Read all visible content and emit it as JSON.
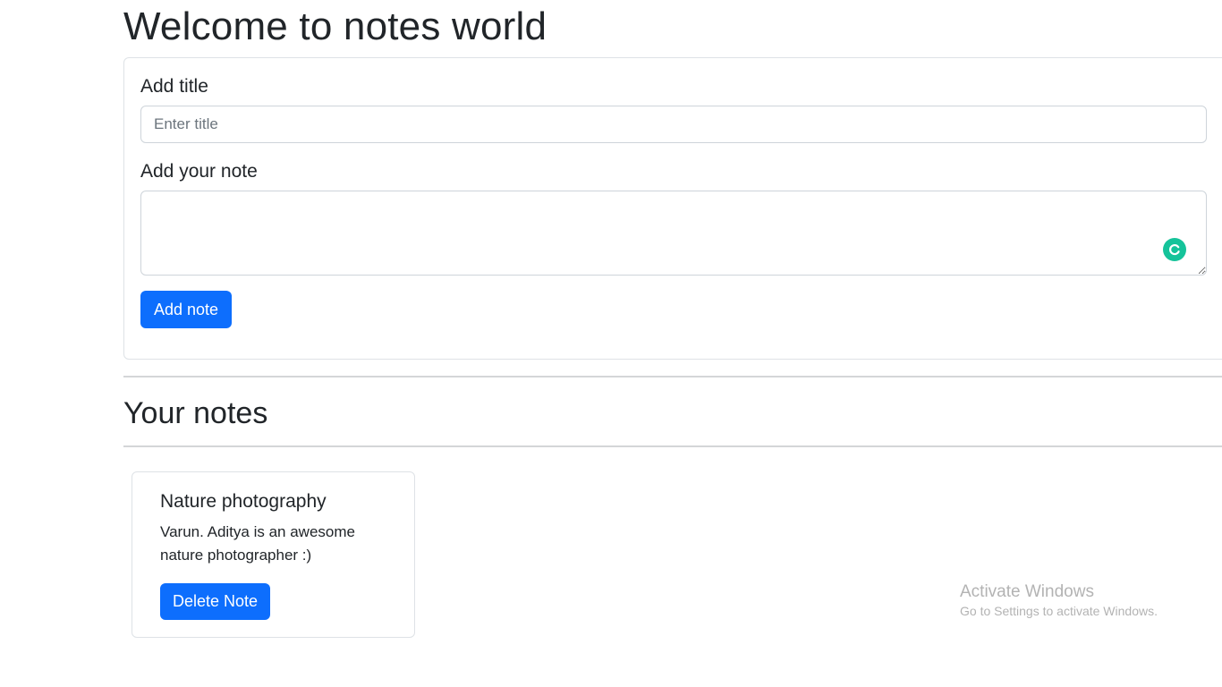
{
  "page": {
    "title": "Welcome to notes world"
  },
  "form": {
    "title_label": "Add title",
    "title_placeholder": "Enter title",
    "note_label": "Add your note",
    "add_button": "Add note"
  },
  "notes_section": {
    "title": "Your notes",
    "notes": [
      {
        "title": "Nature photography",
        "text": "Varun. Aditya is an awesome nature photographer :)",
        "delete_label": "Delete Note"
      }
    ]
  },
  "watermark": {
    "title": "Activate Windows",
    "subtitle": "Go to Settings to activate Windows."
  },
  "colors": {
    "primary": "#0d6efd",
    "grammarly": "#15c39a"
  },
  "icons": [
    "grammarly-icon",
    "resize-grip-icon"
  ]
}
